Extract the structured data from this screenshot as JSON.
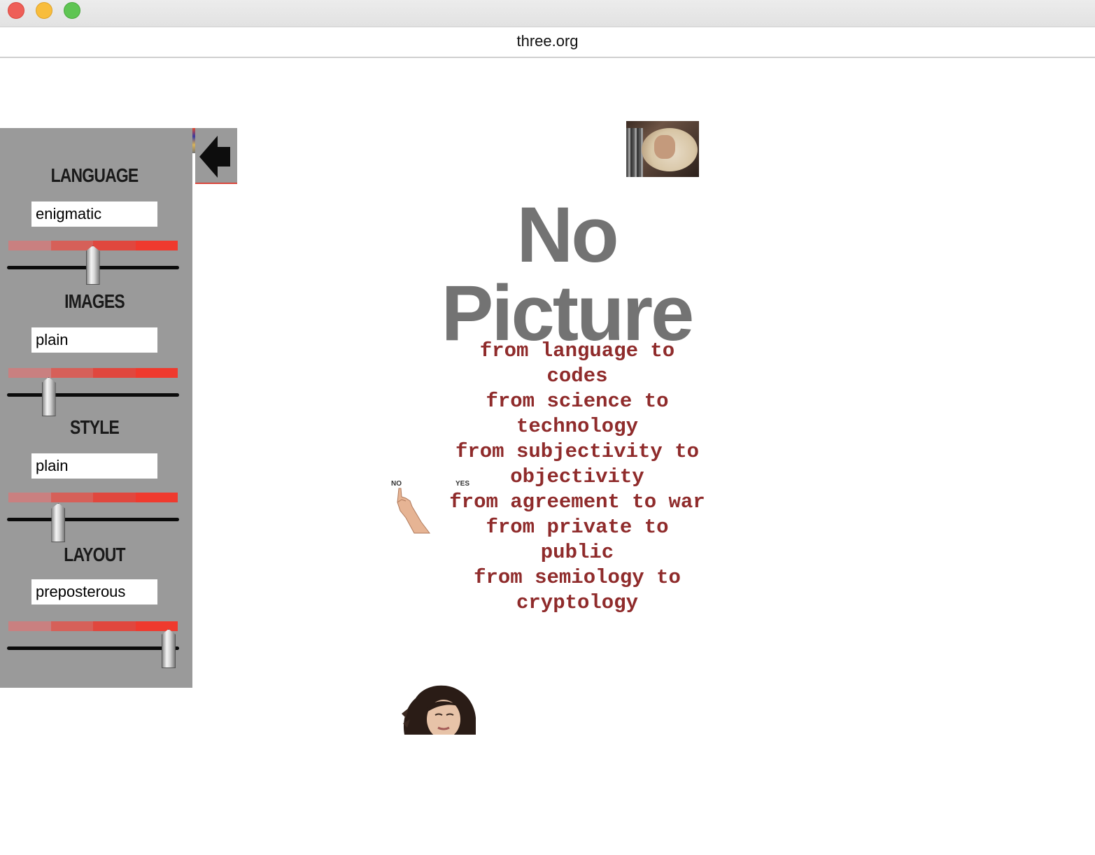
{
  "window": {
    "url": "three.org"
  },
  "controls": [
    {
      "label": "LANGUAGE",
      "value": "enigmatic",
      "level": 0.45
    },
    {
      "label": "IMAGES",
      "value": "plain",
      "level": 0.13
    },
    {
      "label": "STYLE",
      "value": "plain",
      "level": 0.2
    },
    {
      "label": "LAYOUT",
      "value": "preposterous",
      "level": 1.0
    }
  ],
  "content": {
    "no_picture_line1": "No",
    "no_picture_line2": "Picture",
    "poem": [
      "from language to codes",
      "from science to technology",
      "from subjectivity to objectivity",
      "from agreement to war",
      "from private to public",
      "from semiology to cryptology"
    ],
    "vote_no": "NO",
    "vote_yes": "YES"
  },
  "icons": {
    "back": "back-arrow-icon",
    "vote": "pointing-hand-icon"
  },
  "colors": {
    "panel": "#9a9a9a",
    "poem_text": "#8f2b2b",
    "no_picture_text": "#737373",
    "meter_accent": "#ef3a2e"
  }
}
